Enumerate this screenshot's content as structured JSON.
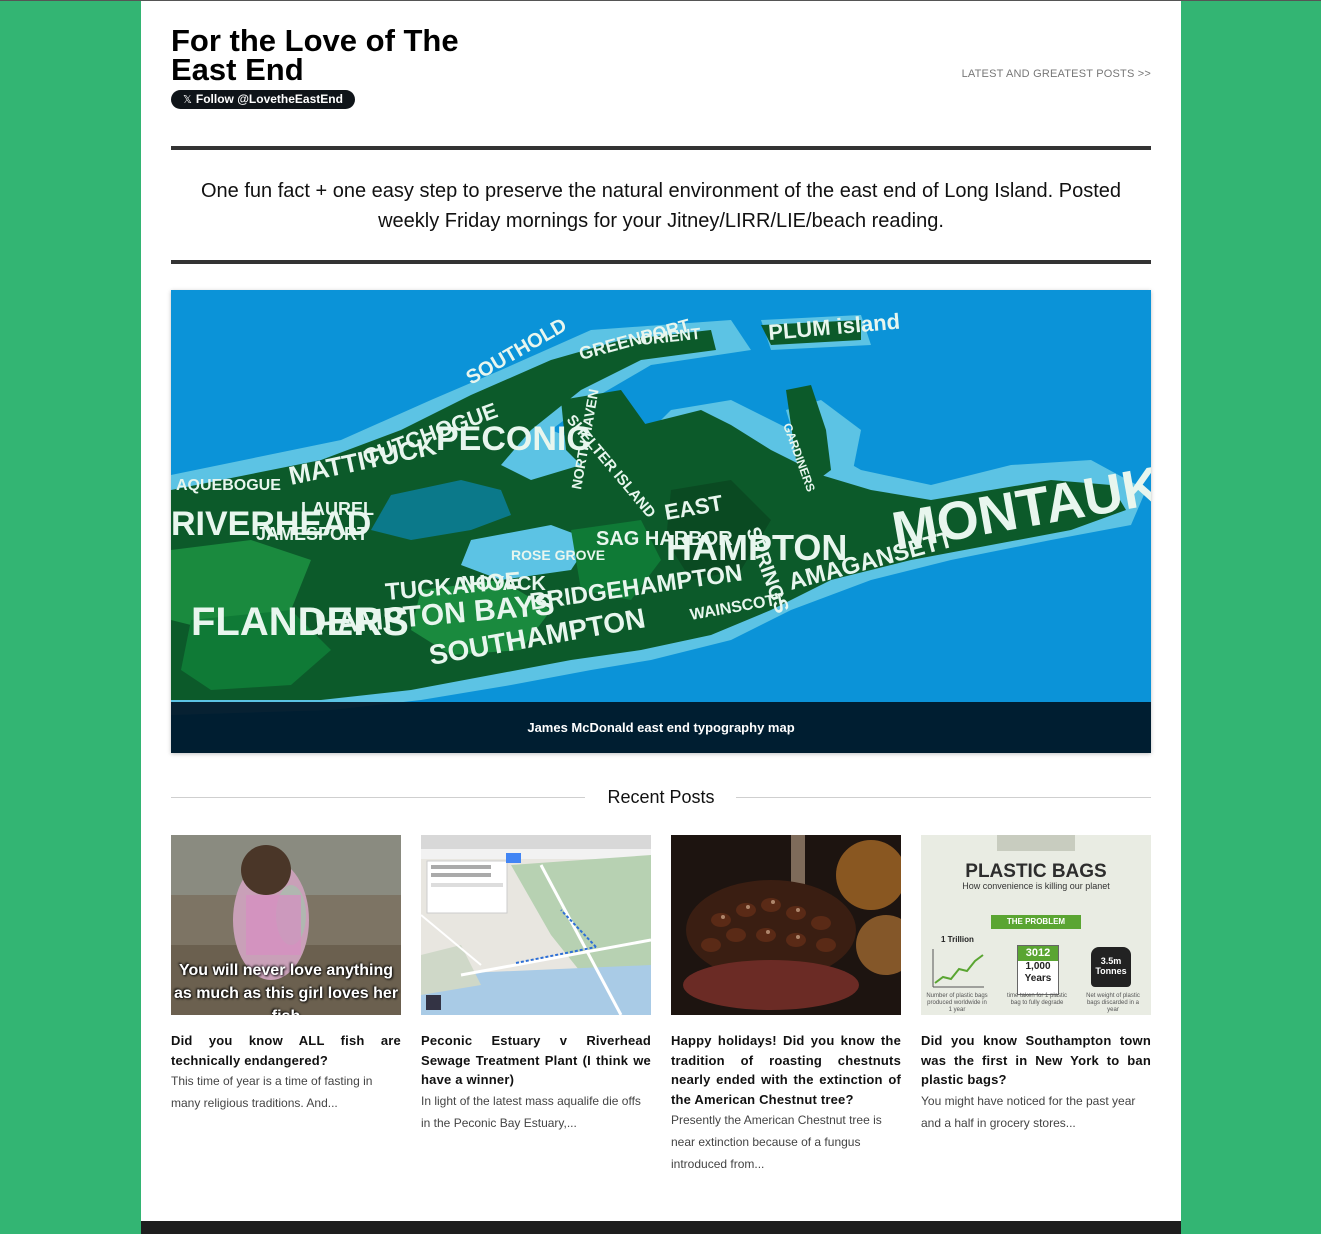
{
  "site": {
    "title": "For the Love of The East End",
    "follow_label": "Follow @LovetheEastEnd",
    "latest_link": "LATEST AND GREATEST POSTS >>",
    "tagline": "One fun fact + one easy step to preserve the natural environment of the east end of Long Island. Posted weekly Friday mornings for your Jitney/LIRR/LIE/beach reading."
  },
  "hero": {
    "caption": "James McDonald east end typography map",
    "map_words": [
      "PLUM island",
      "GARDINERS",
      "SOUTHOLD",
      "GREENPORT",
      "ORIENT",
      "PECONIC",
      "CUTCHOGUE",
      "MATTITUCK",
      "SHELTER ISLAND",
      "NORTH HAVEN",
      "EAST",
      "HAMPTON",
      "MONTAUK",
      "AMAGANSETT",
      "SAG HARBOR",
      "SPRINGS",
      "BRIDGEHAMPTON",
      "RIVERHEAD",
      "FLANDERS",
      "HAMPTON BAYS",
      "SOUTHAMPTON",
      "TUCKAHOE",
      "NOYACK",
      "WAINSCOTT",
      "JAMESPORT",
      "LAUREL",
      "AQUEBOGUE",
      "ROSE GROVE"
    ]
  },
  "recent": {
    "heading": "Recent Posts",
    "posts": [
      {
        "title": "Did you know ALL fish are technically endangered?",
        "excerpt": "This time of year is a time of fasting in many religious traditions. And...",
        "meme_top": "You will never love anything",
        "meme_bottom": "as much as this girl loves her fish"
      },
      {
        "title": "Peconic Estuary v Riverhead Sewage Treatment Plant (I think we have a winner)",
        "excerpt": "In light of the latest mass aqualife die offs in the Peconic Bay Estuary,..."
      },
      {
        "title": "Happy holidays! Did you know the tradition of roasting chestnuts nearly ended with the extinction of the American Chestnut tree?",
        "excerpt": "Presently the American Chestnut tree is near extinction because of a fungus introduced from..."
      },
      {
        "title": "Did you know Southampton town was the first in New York to ban plastic bags?",
        "excerpt": "You might have noticed for the past year and a half in grocery stores...",
        "infographic": {
          "heading": "PLASTIC BAGS",
          "subheading": "How convenience is killing our planet",
          "problem": "THE PROBLEM",
          "stat1": "1 Trillion",
          "stat1_caption": "Number of plastic bags produced worldwide in 1 year",
          "stat2_year": "3012",
          "stat2_value": "1,000",
          "stat2_unit": "Years",
          "stat2_caption": "time taken for 1 plastic bag to fully degrade",
          "stat3_value": "3.5m",
          "stat3_unit": "Tonnes",
          "stat3_caption": "Net weight of plastic bags discarded in a year"
        }
      }
    ]
  },
  "colors": {
    "background": "#33b573",
    "page": "#ffffff",
    "map_ocean": "#0b93d8",
    "map_land": "#0c5a2a"
  }
}
